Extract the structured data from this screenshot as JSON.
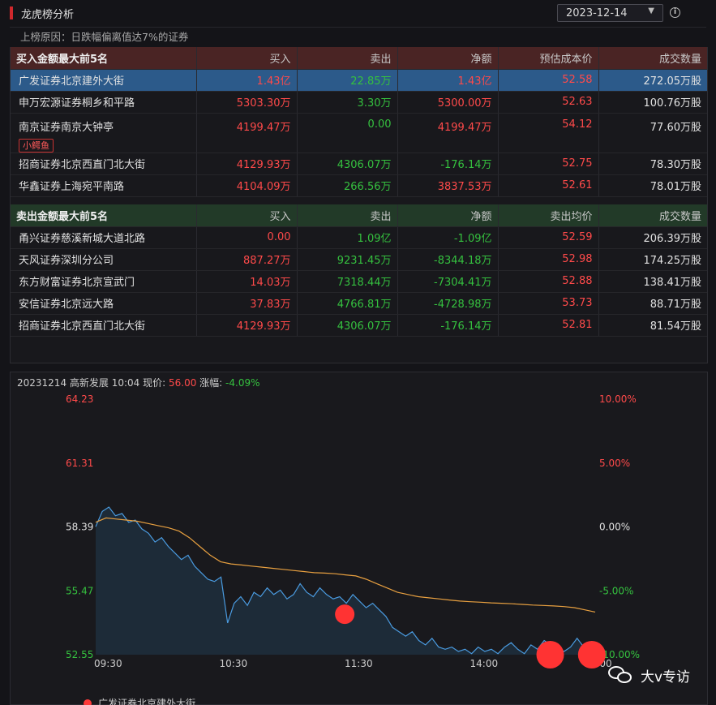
{
  "header": {
    "title": "龙虎榜分析",
    "date": "2023-12-14"
  },
  "reason": "上榜原因：日跌幅偏离值达7%的证券",
  "buy": {
    "headers": [
      "买入金额最大前5名",
      "买入",
      "卖出",
      "净额",
      "预估成本价",
      "成交数量"
    ],
    "rows": [
      {
        "name": "广发证券北京建外大街",
        "buy": "1.43亿",
        "sell": "22.85万",
        "net": "1.43亿",
        "price": "52.58",
        "volume": "272.05万股"
      },
      {
        "name": "申万宏源证券桐乡和平路",
        "buy": "5303.30万",
        "sell": "3.30万",
        "net": "5300.00万",
        "price": "52.63",
        "volume": "100.76万股"
      },
      {
        "name": "南京证券南京大钟亭",
        "tag": "小鳄鱼",
        "buy": "4199.47万",
        "sell": "0.00",
        "net": "4199.47万",
        "price": "54.12",
        "volume": "77.60万股"
      },
      {
        "name": "招商证券北京西直门北大街",
        "buy": "4129.93万",
        "sell": "4306.07万",
        "net": "-176.14万",
        "price": "52.75",
        "volume": "78.30万股"
      },
      {
        "name": "华鑫证券上海宛平南路",
        "buy": "4104.09万",
        "sell": "266.56万",
        "net": "3837.53万",
        "price": "52.61",
        "volume": "78.01万股"
      }
    ]
  },
  "sell": {
    "headers": [
      "卖出金额最大前5名",
      "买入",
      "卖出",
      "净额",
      "卖出均价",
      "成交数量"
    ],
    "rows": [
      {
        "name": "甬兴证券慈溪新城大道北路",
        "buy": "0.00",
        "sell": "1.09亿",
        "net": "-1.09亿",
        "price": "52.59",
        "volume": "206.39万股"
      },
      {
        "name": "天风证券深圳分公司",
        "buy": "887.27万",
        "sell": "9231.45万",
        "net": "-8344.18万",
        "price": "52.98",
        "volume": "174.25万股"
      },
      {
        "name": "东方财富证券北京宣武门",
        "buy": "14.03万",
        "sell": "7318.44万",
        "net": "-7304.41万",
        "price": "52.88",
        "volume": "138.41万股"
      },
      {
        "name": "安信证券北京远大路",
        "buy": "37.83万",
        "sell": "4766.81万",
        "net": "-4728.98万",
        "price": "53.73",
        "volume": "88.71万股"
      },
      {
        "name": "招商证券北京西直门北大街",
        "buy": "4129.93万",
        "sell": "4306.07万",
        "net": "-176.14万",
        "price": "52.81",
        "volume": "81.54万股"
      }
    ]
  },
  "chart_info": {
    "prefix": "20231214 高新发展 10:04 现价:",
    "price": "56.00",
    "change_label": "涨幅:",
    "change": "-4.09%"
  },
  "chart_data": {
    "type": "line",
    "y_left_ticks": [
      "64.23",
      "61.31",
      "58.39",
      "55.47",
      "52.55"
    ],
    "y_right_ticks": [
      "10.00%",
      "5.00%",
      "0.00%",
      "-5.00%",
      "-10.00%"
    ],
    "x_ticks": [
      "09:30",
      "10:30",
      "11:30",
      "14:00",
      "15:00"
    ],
    "ylim": [
      52.55,
      64.23
    ],
    "prev_close": 58.39,
    "series": [
      {
        "values": [
          58.4,
          59.1,
          59.3,
          58.9,
          59.0,
          58.6,
          58.7,
          58.3,
          58.1,
          57.7,
          57.9,
          57.5,
          57.2,
          56.9,
          57.1,
          56.6,
          56.3,
          56.0,
          55.9,
          56.1,
          54.0,
          54.9,
          55.2,
          54.8,
          55.4,
          55.2,
          55.6,
          55.3,
          55.5,
          55.1,
          55.3,
          55.8,
          55.4,
          55.2,
          55.6,
          55.3,
          55.1,
          55.2,
          54.9,
          55.3,
          55.0,
          54.7,
          54.9,
          54.6,
          54.3,
          53.8,
          53.6,
          53.4,
          53.6,
          53.2,
          53.0,
          53.3,
          52.9,
          52.8,
          52.9,
          52.7,
          52.8,
          52.6,
          52.9,
          52.7,
          52.8,
          52.6,
          52.9,
          53.1,
          52.8,
          52.6,
          53.0,
          52.8,
          53.2,
          53.0,
          52.9,
          52.7,
          52.9,
          53.3,
          52.9,
          52.7
        ]
      },
      {
        "values": [
          58.6,
          58.8,
          58.75,
          58.7,
          58.65,
          58.55,
          58.45,
          58.35,
          58.2,
          57.9,
          57.5,
          57.1,
          56.8,
          56.7,
          56.65,
          56.6,
          56.55,
          56.5,
          56.45,
          56.4,
          56.35,
          56.3,
          56.28,
          56.25,
          56.2,
          56.15,
          56.0,
          55.8,
          55.6,
          55.4,
          55.3,
          55.2,
          55.15,
          55.1,
          55.05,
          55.0,
          54.97,
          54.95,
          54.92,
          54.9,
          54.88,
          54.85,
          54.82,
          54.8,
          54.78,
          54.75,
          54.7,
          54.6,
          54.5
        ]
      }
    ],
    "markers": [
      {
        "x_frac": 0.497,
        "value": 54.4
      },
      {
        "x_frac": 0.907,
        "value": 52.55
      },
      {
        "x_frac": 0.99,
        "value": 52.55
      }
    ],
    "legend": "广发证券北京建外大街"
  },
  "watermark": "大v专访",
  "colors": {
    "up": "#ff4a4a",
    "down": "#35c13f",
    "price_line": "#4a9be0",
    "avg_line": "#e8a040",
    "marker": "#ff3333"
  }
}
